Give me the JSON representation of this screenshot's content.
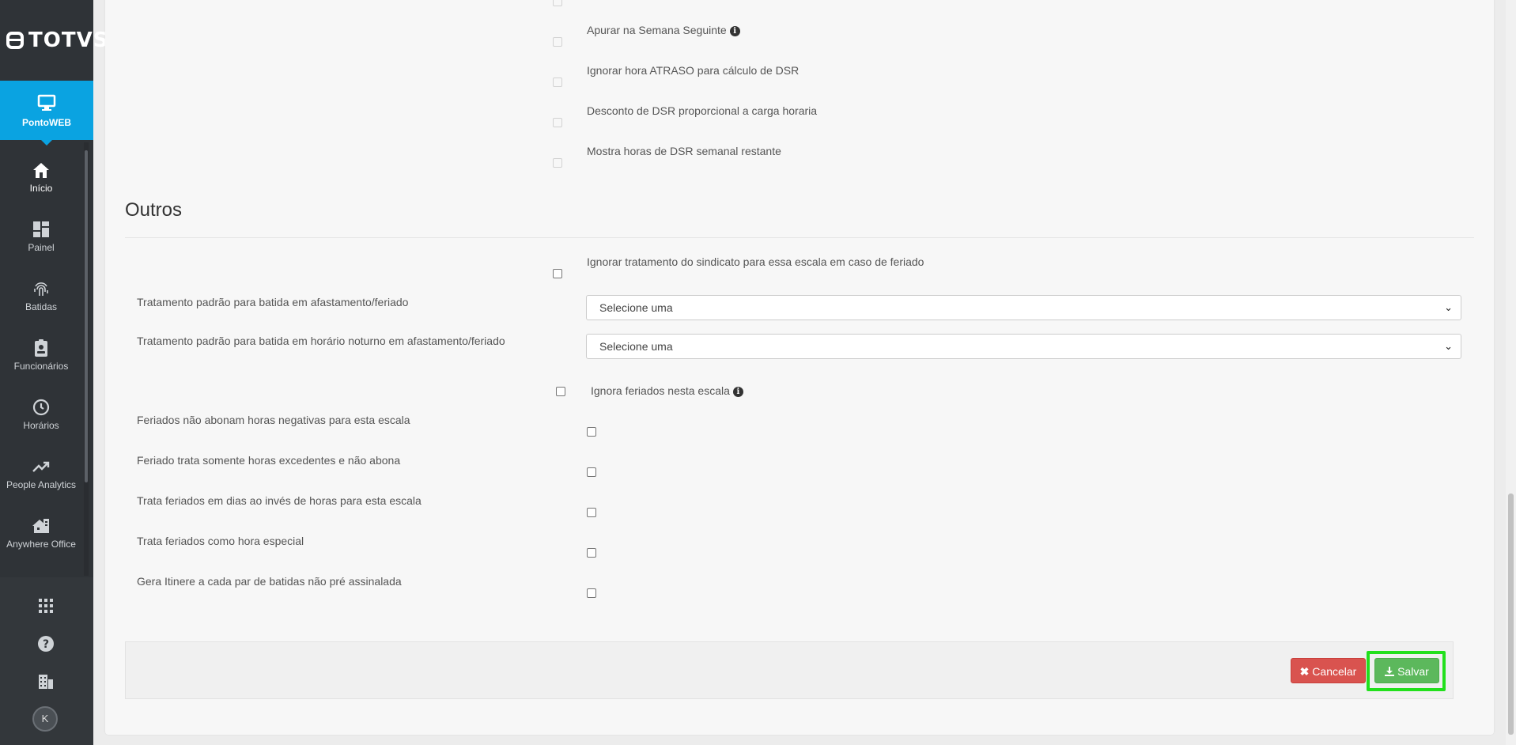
{
  "brand": {
    "name": "TOTVS"
  },
  "sidebar": {
    "active_app": "PontoWEB",
    "items": [
      {
        "label": "Início",
        "icon": "home-icon"
      },
      {
        "label": "Painel",
        "icon": "dashboard-icon"
      },
      {
        "label": "Batidas",
        "icon": "fingerprint-icon"
      },
      {
        "label": "Funcionários",
        "icon": "id-badge-icon"
      },
      {
        "label": "Horários",
        "icon": "clock-icon"
      },
      {
        "label": "People Analytics",
        "icon": "trend-icon"
      },
      {
        "label": "Anywhere Office",
        "icon": "home-office-icon"
      }
    ],
    "avatar_initial": "K"
  },
  "dsr_options": [
    {
      "label": "Apurar na Semana Seguinte",
      "has_info": true
    },
    {
      "label": "Ignorar hora ATRASO para cálculo de DSR"
    },
    {
      "label": "Desconto de DSR proporcional a carga horaria"
    },
    {
      "label": "Mostra horas de DSR semanal restante"
    }
  ],
  "outros": {
    "title": "Outros",
    "ignore_union": "Ignorar tratamento do sindicato para essa escala em caso de feriado",
    "select_leave_label": "Tratamento padrão para batida em afastamento/feriado",
    "select_leave_value": "Selecione uma",
    "select_night_label": "Tratamento padrão para batida em horário noturno em afastamento/feriado",
    "select_night_value": "Selecione uma",
    "ignore_holidays": "Ignora feriados nesta escala",
    "rows": [
      {
        "label": "Feriados não abonam horas negativas para esta escala"
      },
      {
        "label": "Feriado trata somente horas excedentes e não abona"
      },
      {
        "label": "Trata feriados em dias ao invés de horas para esta escala"
      },
      {
        "label": "Trata feriados como hora especial"
      },
      {
        "label": "Gera Itinere a cada par de batidas não pré assinalada"
      }
    ]
  },
  "actions": {
    "cancel": "Cancelar",
    "save": "Salvar"
  },
  "colors": {
    "sidebar": "#2f3337",
    "active": "#0aa3e1",
    "cancel": "#d9534f",
    "save": "#5cb85c",
    "highlight": "#22e01c"
  }
}
